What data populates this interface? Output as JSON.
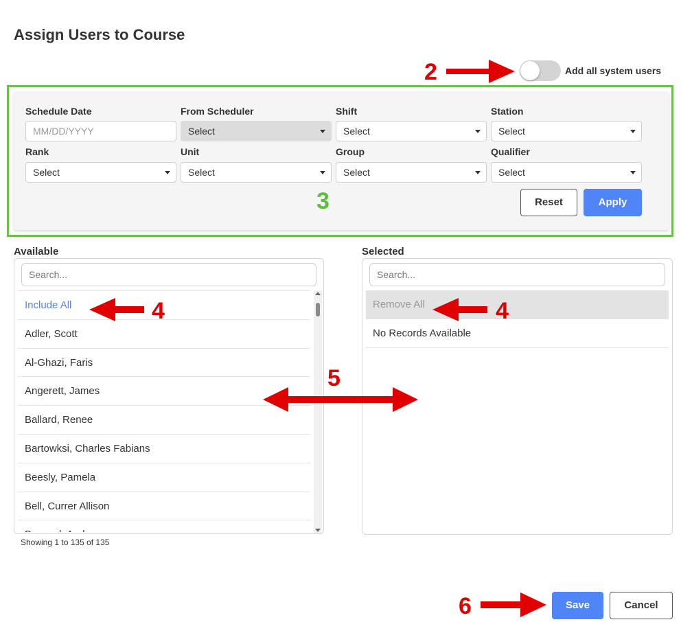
{
  "title": "Assign Users to Course",
  "toggle": {
    "label": "Add all system users",
    "on": false
  },
  "filters": {
    "schedule_date": {
      "label": "Schedule Date",
      "placeholder": "MM/DD/YYYY"
    },
    "from_scheduler": {
      "label": "From Scheduler",
      "value": "Select",
      "disabled": true
    },
    "shift": {
      "label": "Shift",
      "value": "Select"
    },
    "station": {
      "label": "Station",
      "value": "Select"
    },
    "rank": {
      "label": "Rank",
      "value": "Select"
    },
    "unit": {
      "label": "Unit",
      "value": "Select"
    },
    "group": {
      "label": "Group",
      "value": "Select"
    },
    "qualifier": {
      "label": "Qualifier",
      "value": "Select"
    },
    "reset_label": "Reset",
    "apply_label": "Apply"
  },
  "available": {
    "label": "Available",
    "search_placeholder": "Search...",
    "include_all": "Include All",
    "users": [
      "Adler, Scott",
      "Al-Ghazi, Faris",
      "Angerett, James",
      "Ballard, Renee",
      "Bartowksi, Charles Fabians",
      "Beesly, Pamela",
      "Bell, Currer Allison",
      "Bernard, Andy"
    ],
    "showing": "Showing 1 to 135 of 135"
  },
  "selected": {
    "label": "Selected",
    "search_placeholder": "Search...",
    "remove_all": "Remove All",
    "empty": "No Records Available"
  },
  "footer": {
    "save_label": "Save",
    "cancel_label": "Cancel"
  },
  "annotations": [
    "2",
    "3",
    "4",
    "4",
    "5",
    "6"
  ],
  "colors": {
    "accent": "#4f85f6",
    "annotation": "#e00000",
    "highlight": "#6cbf4b",
    "toggle_off": "#d4d4d4"
  }
}
